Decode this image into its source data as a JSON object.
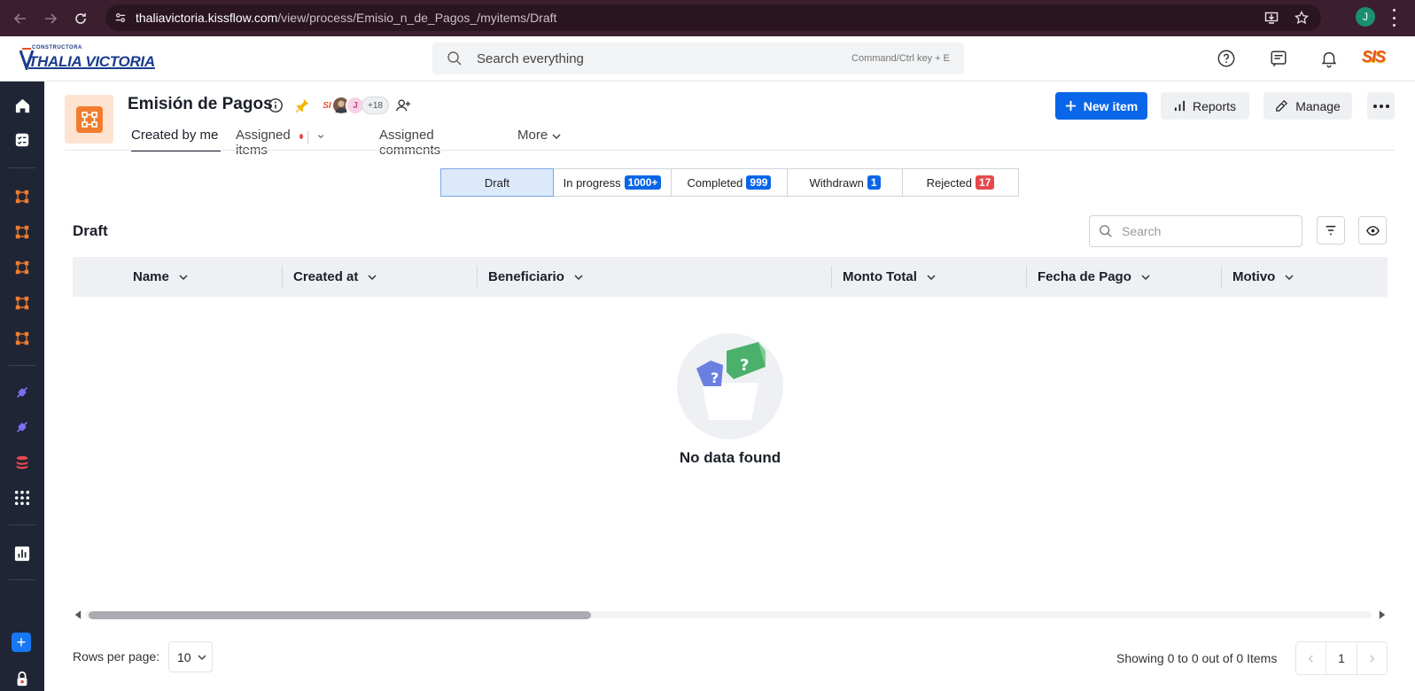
{
  "browser": {
    "url_host": "thaliavictoria.kissflow.com",
    "url_path": "/view/process/Emisio_n_de_Pagos_/myitems/Draft",
    "profile_initial": "J"
  },
  "header": {
    "logo_small": "CONSTRUCTORA",
    "logo_main": "THALIA VICTORIA",
    "search_placeholder": "Search everything",
    "search_hint": "Command/Ctrl key + E",
    "brand_badge": "SIS"
  },
  "page": {
    "title": "Emisión de Pagos",
    "avatar_1": "SI",
    "avatar_3": "J",
    "avatar_count": "+18",
    "tabs": [
      {
        "label": "Created by me"
      },
      {
        "label": "Assigned items"
      },
      {
        "label": "Assigned comments"
      },
      {
        "label": "More"
      }
    ],
    "buttons": {
      "new_item": "New item",
      "reports": "Reports",
      "manage": "Manage"
    }
  },
  "status_segments": [
    {
      "label": "Draft",
      "count": ""
    },
    {
      "label": "In progress",
      "count": "1000+",
      "color": "#0a66e8"
    },
    {
      "label": "Completed",
      "count": "999",
      "color": "#0a66e8"
    },
    {
      "label": "Withdrawn",
      "count": "1",
      "color": "#0a66e8"
    },
    {
      "label": "Rejected",
      "count": "17",
      "color": "#e5484d"
    }
  ],
  "list": {
    "section_title": "Draft",
    "search_placeholder": "Search",
    "columns": [
      "Name",
      "Created at",
      "Beneficiario",
      "Monto Total",
      "Fecha de Pago",
      "Motivo"
    ],
    "empty_text": "No data found"
  },
  "footer": {
    "rows_label": "Rows per page:",
    "rows_value": "10",
    "showing_text": "Showing 0 to 0 out of 0 Items",
    "page_number": "1"
  }
}
